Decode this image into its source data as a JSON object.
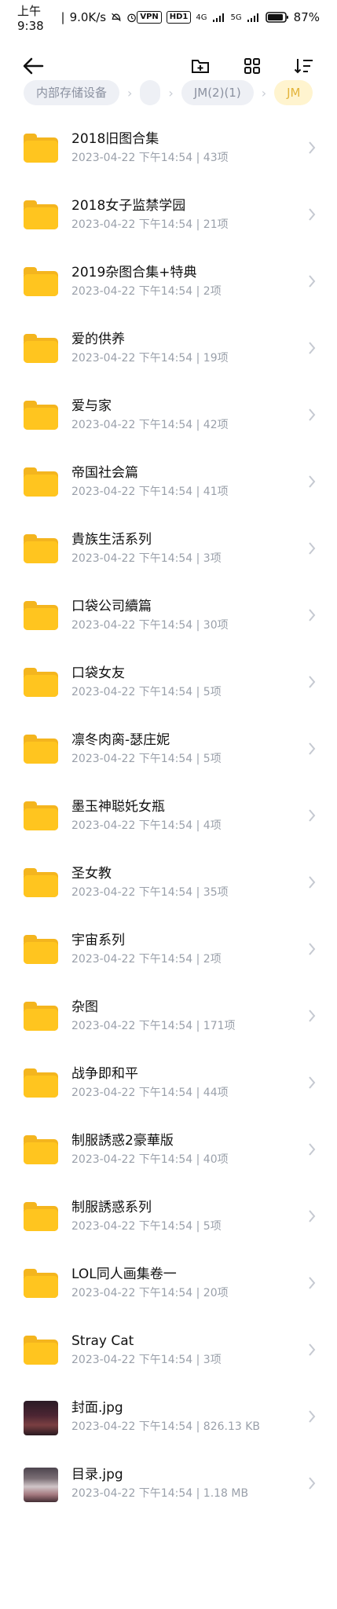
{
  "status_bar": {
    "time": "上午9:38",
    "speed": "9.0K/s",
    "vpn_label": "VPN",
    "hd_label": "HD1",
    "signal_1": "4G",
    "signal_2": "5G",
    "battery": "87%"
  },
  "toolbar": {
    "back_icon": "back-arrow-icon",
    "new_folder_icon": "new-folder-icon",
    "grid_icon": "grid-view-icon",
    "sort_icon": "sort-icon"
  },
  "breadcrumb": [
    {
      "label": "内部存储设备"
    },
    {
      "label": ""
    },
    {
      "label": "JM(2)(1)"
    },
    {
      "label": "JM"
    }
  ],
  "files": [
    {
      "name": "2018旧图合集",
      "date": "2023-04-22 下午14:54",
      "detail": "43项",
      "type": "folder"
    },
    {
      "name": "2018女子监禁学园",
      "date": "2023-04-22 下午14:54",
      "detail": "21项",
      "type": "folder"
    },
    {
      "name": "2019杂图合集+特典",
      "date": "2023-04-22 下午14:54",
      "detail": "2项",
      "type": "folder"
    },
    {
      "name": "爱的供养",
      "date": "2023-04-22 下午14:54",
      "detail": "19项",
      "type": "folder"
    },
    {
      "name": "爱与家",
      "date": "2023-04-22 下午14:54",
      "detail": "42项",
      "type": "folder"
    },
    {
      "name": "帝国社会篇",
      "date": "2023-04-22 下午14:54",
      "detail": "41项",
      "type": "folder"
    },
    {
      "name": "貴族生活系列",
      "date": "2023-04-22 下午14:54",
      "detail": "3项",
      "type": "folder"
    },
    {
      "name": "口袋公司續篇",
      "date": "2023-04-22 下午14:54",
      "detail": "30项",
      "type": "folder"
    },
    {
      "name": "口袋女友",
      "date": "2023-04-22 下午14:54",
      "detail": "5项",
      "type": "folder"
    },
    {
      "name": "凛冬肉脔-瑟庄妮",
      "date": "2023-04-22 下午14:54",
      "detail": "5项",
      "type": "folder"
    },
    {
      "name": "墨玉神聪奼女瓶",
      "date": "2023-04-22 下午14:54",
      "detail": "4项",
      "type": "folder"
    },
    {
      "name": "圣女教",
      "date": "2023-04-22 下午14:54",
      "detail": "35项",
      "type": "folder"
    },
    {
      "name": "宇宙系列",
      "date": "2023-04-22 下午14:54",
      "detail": "2项",
      "type": "folder"
    },
    {
      "name": "杂图",
      "date": "2023-04-22 下午14:54",
      "detail": "171项",
      "type": "folder"
    },
    {
      "name": "战争即和平",
      "date": "2023-04-22 下午14:54",
      "detail": "44项",
      "type": "folder"
    },
    {
      "name": "制服誘惑2豪華版",
      "date": "2023-04-22 下午14:54",
      "detail": "40项",
      "type": "folder"
    },
    {
      "name": "制服誘惑系列",
      "date": "2023-04-22 下午14:54",
      "detail": "5项",
      "type": "folder"
    },
    {
      "name": "LOL同人画集卷一",
      "date": "2023-04-22 下午14:54",
      "detail": "20项",
      "type": "folder"
    },
    {
      "name": "Stray Cat",
      "date": "2023-04-22 下午14:54",
      "detail": "3项",
      "type": "folder"
    },
    {
      "name": "封面.jpg",
      "date": "2023-04-22 下午14:54",
      "detail": "826.13 KB",
      "type": "image"
    },
    {
      "name": "目录.jpg",
      "date": "2023-04-22 下午14:54",
      "detail": "1.18 MB",
      "type": "image"
    }
  ]
}
